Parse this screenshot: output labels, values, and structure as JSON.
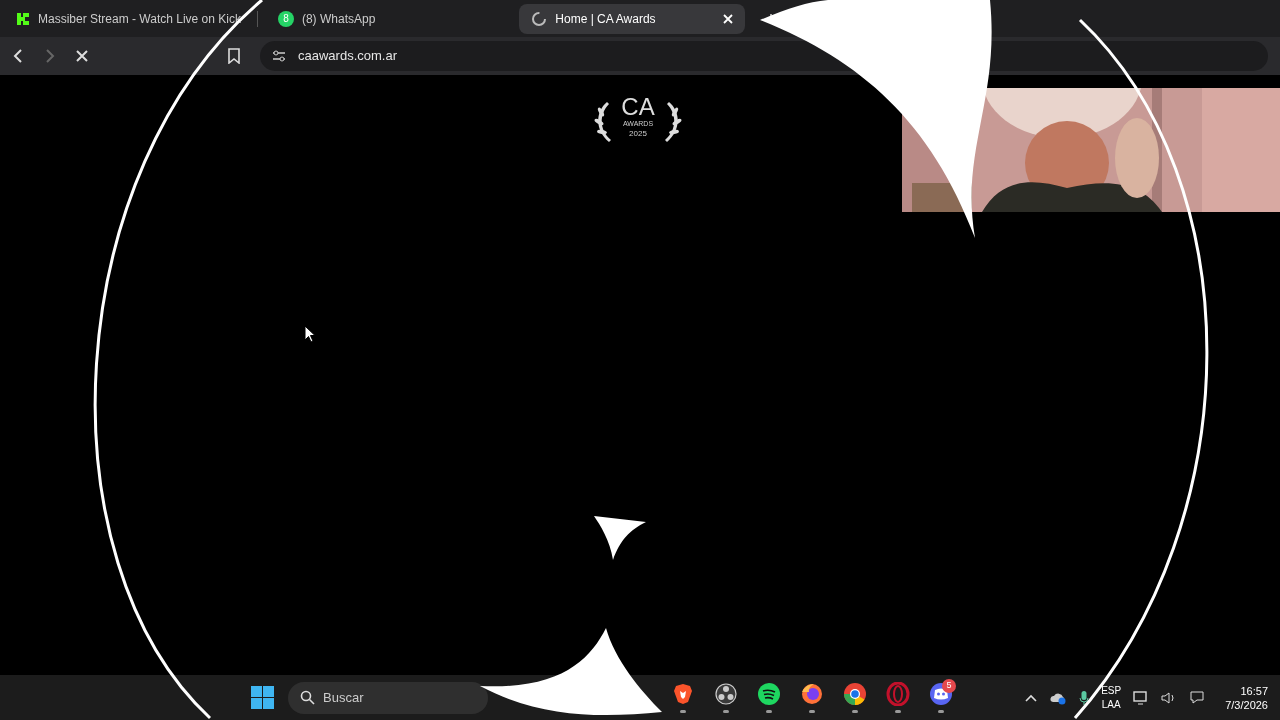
{
  "tabs": [
    {
      "title": "Massiber Stream - Watch Live on Kick",
      "kind": "kick",
      "selected": false
    },
    {
      "title": "(8) WhatsApp",
      "kind": "whatsapp",
      "badge": "8",
      "selected": false
    },
    {
      "title": "Home | CA Awards",
      "kind": "loading",
      "selected": true
    }
  ],
  "address_bar": {
    "url": "caawards.com.ar"
  },
  "page": {
    "logo": {
      "title": "CA",
      "subtitle": "AWARDS",
      "year": "2025"
    }
  },
  "taskbar": {
    "search": {
      "placeholder": "Buscar"
    },
    "apps": [
      {
        "kind": "brave",
        "running": true
      },
      {
        "kind": "obs",
        "running": true
      },
      {
        "kind": "spotify",
        "running": true
      },
      {
        "kind": "firefox",
        "running": true
      },
      {
        "kind": "chrome",
        "running": true
      },
      {
        "kind": "opera",
        "running": true
      },
      {
        "kind": "discord",
        "badge": "5",
        "running": true
      }
    ],
    "tray": {
      "language": "ESP",
      "layout": "LAA",
      "time": "16:57",
      "date": "7/3/2026"
    }
  }
}
